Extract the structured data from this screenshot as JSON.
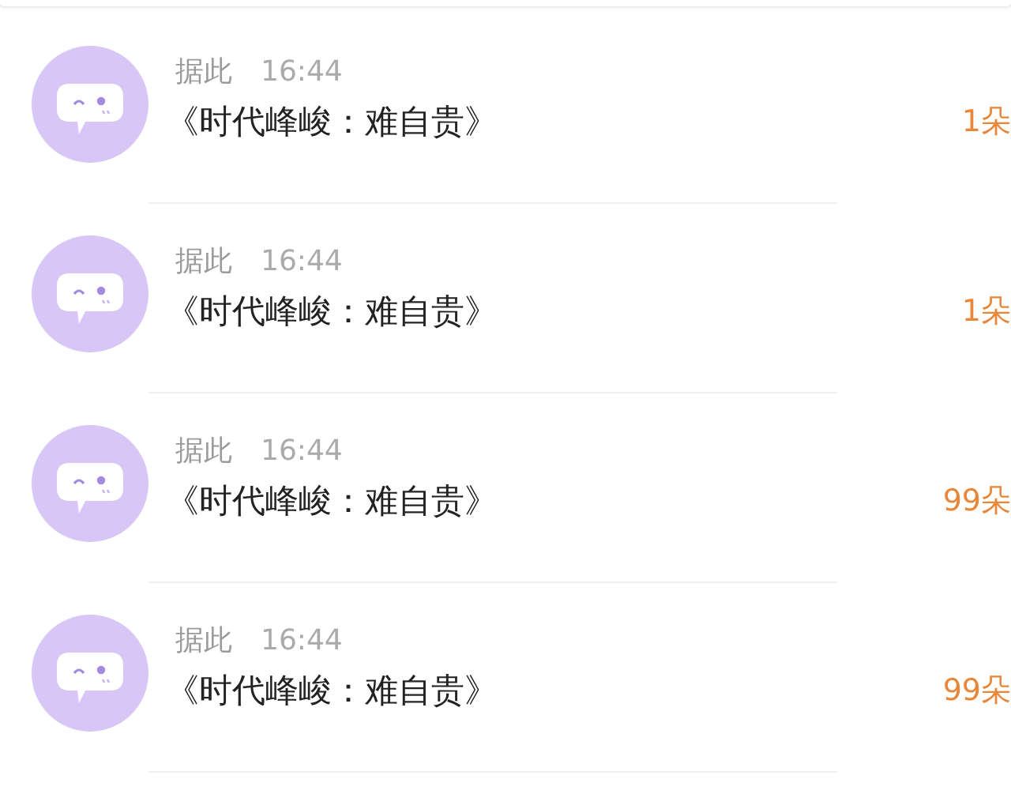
{
  "messages": [
    {
      "sender": "据此",
      "time": "16:44",
      "title": "《时代峰峻：难自贵》",
      "count": "1朵"
    },
    {
      "sender": "据此",
      "time": "16:44",
      "title": "《时代峰峻：难自贵》",
      "count": "1朵"
    },
    {
      "sender": "据此",
      "time": "16:44",
      "title": "《时代峰峻：难自贵》",
      "count": "99朵"
    },
    {
      "sender": "据此",
      "time": "16:44",
      "title": "《时代峰峻：难自贵》",
      "count": "99朵"
    }
  ]
}
